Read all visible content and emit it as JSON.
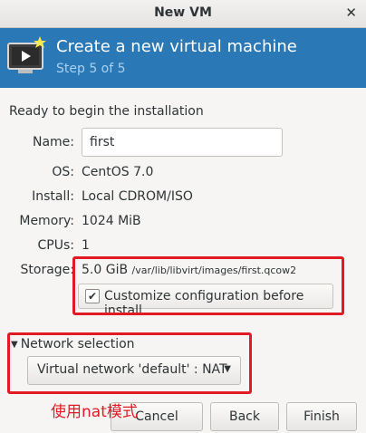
{
  "window": {
    "title": "New VM",
    "close_glyph": "✕"
  },
  "header": {
    "title": "Create a new virtual machine",
    "step": "Step 5 of 5",
    "icon": "monitor-with-star-icon"
  },
  "intro": "Ready to begin the installation",
  "fields": {
    "name_label": "Name:",
    "name_value": "first",
    "os_label": "OS:",
    "os_value": "CentOS 7.0",
    "install_label": "Install:",
    "install_value": "Local CDROM/ISO",
    "memory_label": "Memory:",
    "memory_value": "1024 MiB",
    "cpus_label": "CPUs:",
    "cpus_value": "1",
    "storage_label": "Storage:",
    "storage_size": "5.0 GiB",
    "storage_path": "/var/lib/libvirt/images/first.qcow2"
  },
  "customize": {
    "label": "Customize configuration before install",
    "checked": true,
    "check_glyph": "✔"
  },
  "network": {
    "expander_label": "Network selection",
    "expander_glyph": "▼",
    "selected": "Virtual network 'default' : NAT",
    "caret_glyph": "▼"
  },
  "buttons": {
    "cancel": "Cancel",
    "back": "Back",
    "finish": "Finish"
  },
  "annotation": {
    "text": "使用nat模式",
    "color": "#e01b24"
  },
  "colors": {
    "header_bg": "#2a78b6",
    "highlight_red": "#e01b24"
  }
}
